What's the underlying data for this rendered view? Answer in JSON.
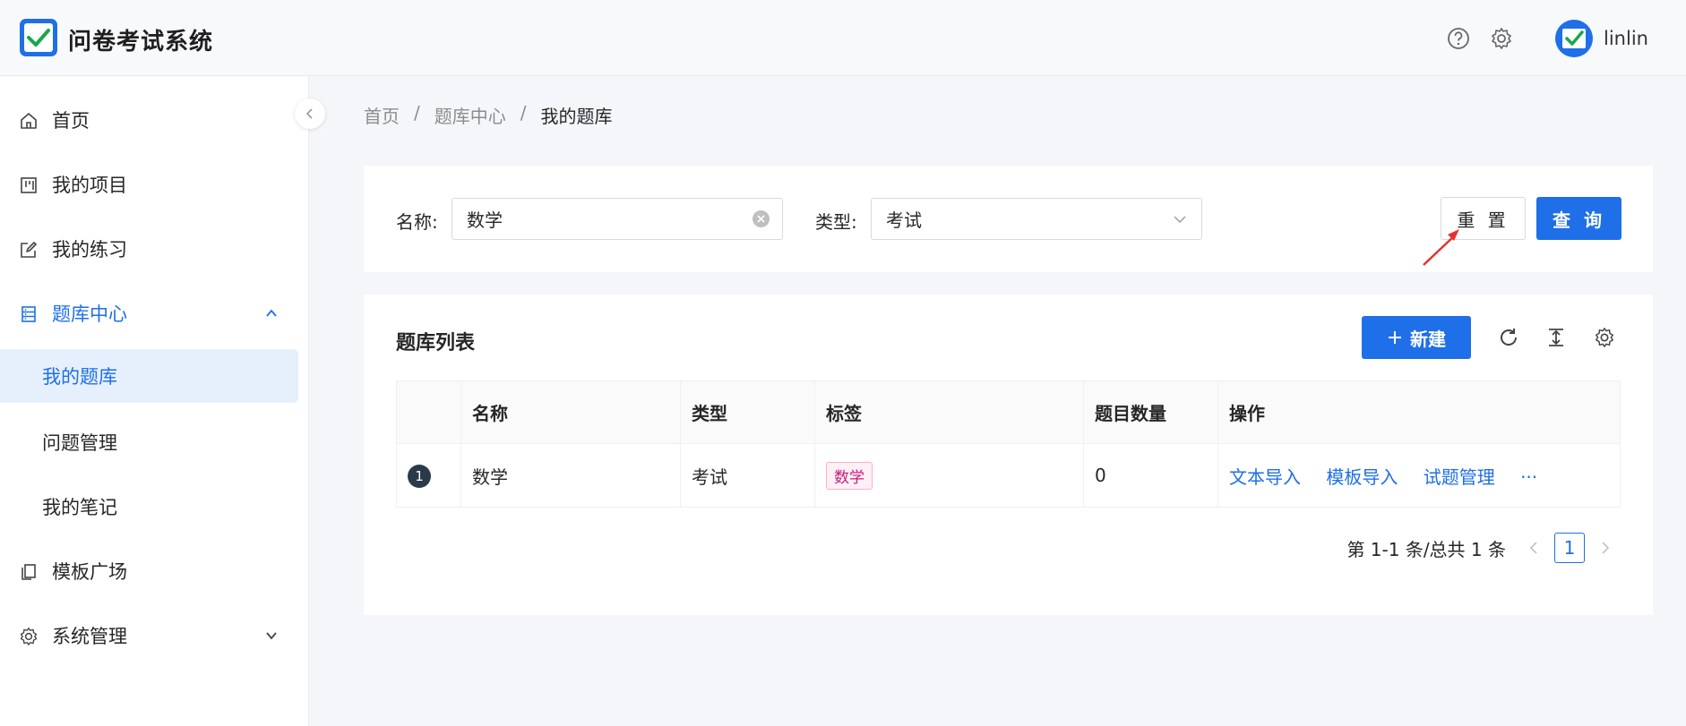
{
  "header": {
    "app_title": "问卷考试系统",
    "username": "linlin",
    "icons": [
      "help-icon",
      "settings-icon"
    ]
  },
  "sidebar": {
    "items": [
      {
        "label": "首页",
        "icon": "home-icon"
      },
      {
        "label": "我的项目",
        "icon": "project-icon"
      },
      {
        "label": "我的练习",
        "icon": "edit-icon"
      },
      {
        "label": "题库中心",
        "icon": "database-icon",
        "expanded": true
      },
      {
        "label": "我的题库",
        "selected": true
      },
      {
        "label": "问题管理"
      },
      {
        "label": "我的笔记"
      },
      {
        "label": "模板广场",
        "icon": "copy-icon"
      },
      {
        "label": "系统管理",
        "icon": "gear-icon",
        "expanded": false
      }
    ]
  },
  "breadcrumb": {
    "home": "首页",
    "sep": "/",
    "center": "题库中心",
    "current": "我的题库"
  },
  "search": {
    "name_label": "名称:",
    "name_value": "数学",
    "type_label": "类型:",
    "type_value": "考试",
    "reset_label": "重 置",
    "query_label": "查 询"
  },
  "list": {
    "title": "题库列表",
    "new_label": "新建",
    "columns": [
      "",
      "名称",
      "类型",
      "标签",
      "题目数量",
      "操作"
    ],
    "rows": [
      {
        "index": "1",
        "name": "数学",
        "type": "考试",
        "tag": "数学",
        "count": "0",
        "ops": [
          "文本导入",
          "模板导入",
          "试题管理",
          "···"
        ]
      }
    ],
    "pagination": {
      "summary": "第 1-1 条/总共 1 条",
      "current_page": "1"
    }
  },
  "colors": {
    "accent": "#1e6fe8",
    "tag": "#c41d7f",
    "annotation": "#e8312f"
  }
}
